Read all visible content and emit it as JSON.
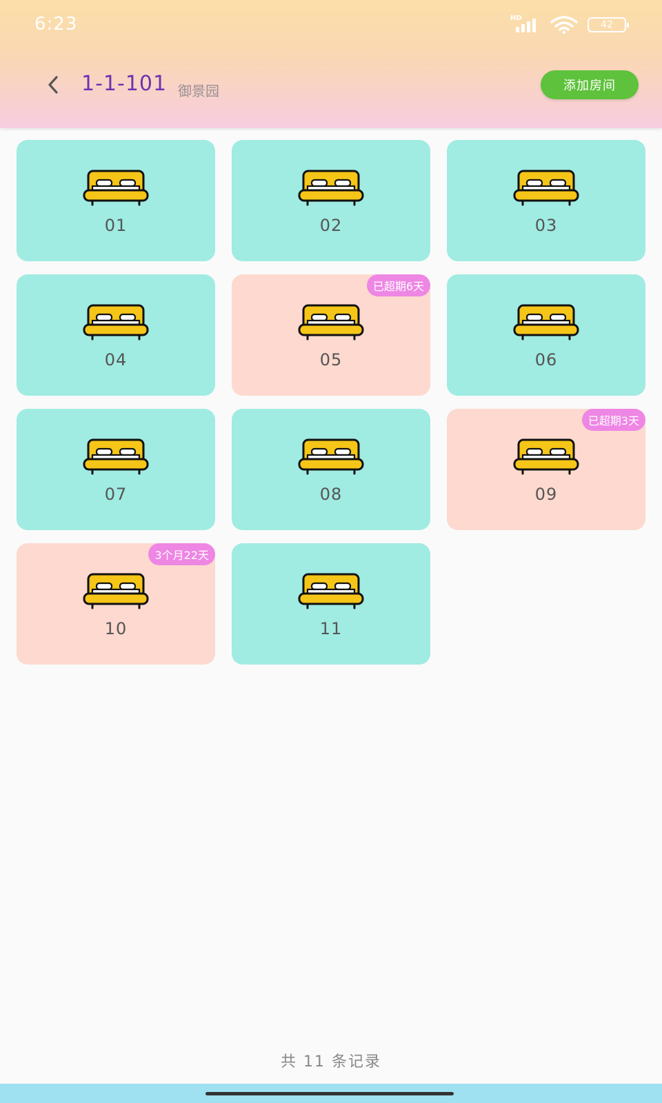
{
  "status_bar": {
    "time": "6:23",
    "network_label": "HD",
    "battery": "42"
  },
  "header": {
    "title": "1-1-101",
    "subtitle": "御景园",
    "add_button_label": "添加房间"
  },
  "colors": {
    "title": "#6a35b0",
    "add_button": "#5ec23c",
    "card_normal": "#a0ebe2",
    "card_overdue": "#fdd9cf",
    "badge": "#ee86e4",
    "bed": "#f5c518"
  },
  "rooms": [
    {
      "number": "01",
      "status": "normal",
      "badge": ""
    },
    {
      "number": "02",
      "status": "normal",
      "badge": ""
    },
    {
      "number": "03",
      "status": "normal",
      "badge": ""
    },
    {
      "number": "04",
      "status": "normal",
      "badge": ""
    },
    {
      "number": "05",
      "status": "overdue",
      "badge": "已超期6天"
    },
    {
      "number": "06",
      "status": "normal",
      "badge": ""
    },
    {
      "number": "07",
      "status": "normal",
      "badge": ""
    },
    {
      "number": "08",
      "status": "normal",
      "badge": ""
    },
    {
      "number": "09",
      "status": "overdue",
      "badge": "已超期3天"
    },
    {
      "number": "10",
      "status": "overdue",
      "badge": "3个月22天"
    },
    {
      "number": "11",
      "status": "normal",
      "badge": ""
    }
  ],
  "footer": {
    "count_text": "共 11 条记录"
  },
  "icons": {
    "back": "chevron-left-icon",
    "room": "bed-icon",
    "signal": "signal-icon",
    "wifi": "wifi-icon",
    "battery": "battery-icon"
  }
}
